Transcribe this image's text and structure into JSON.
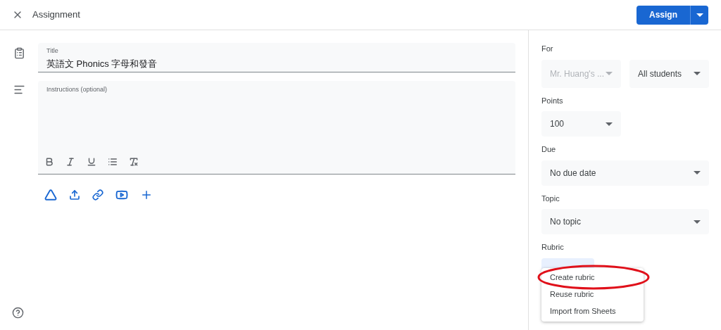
{
  "window": {
    "title": "Assignment"
  },
  "assign_button": {
    "label": "Assign"
  },
  "title_field": {
    "label": "Title",
    "value": "英語文 Phonics 字母和發音"
  },
  "instructions_field": {
    "placeholder": "Instructions (optional)"
  },
  "sidebar": {
    "for": {
      "label": "For",
      "selects": [
        {
          "value": "Mr. Huang's ...",
          "disabled": true
        },
        {
          "value": "All students",
          "disabled": false
        }
      ]
    },
    "points": {
      "label": "Points",
      "value": "100"
    },
    "due": {
      "label": "Due",
      "value": "No due date"
    },
    "topic": {
      "label": "Topic",
      "value": "No topic"
    },
    "rubric": {
      "label": "Rubric",
      "menu": [
        {
          "label": "Create rubric"
        },
        {
          "label": "Reuse rubric"
        },
        {
          "label": "Import from Sheets"
        }
      ]
    }
  }
}
